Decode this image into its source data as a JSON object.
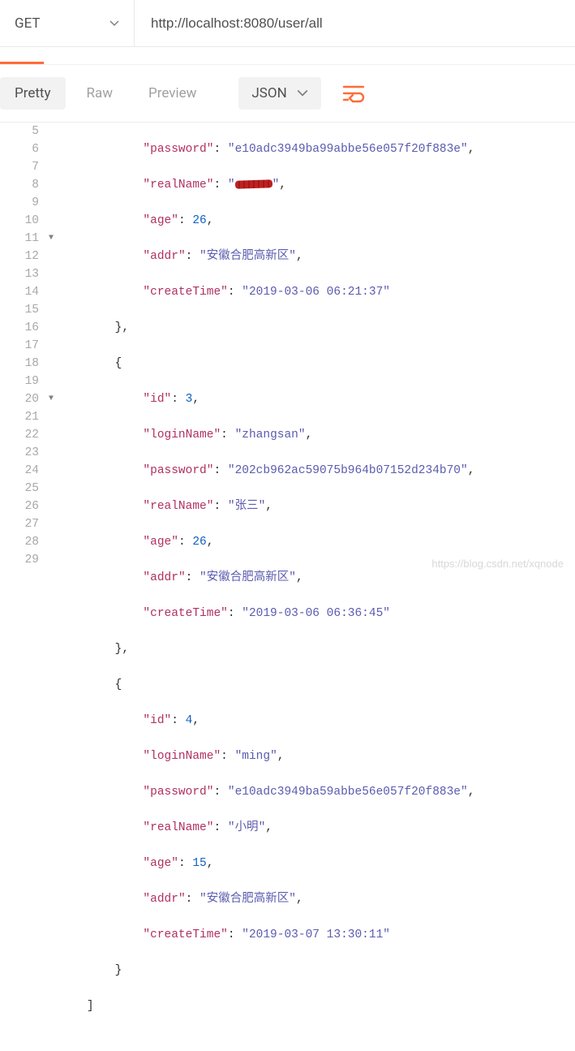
{
  "request": {
    "method": "GET",
    "url": "http://localhost:8080/user/all"
  },
  "tabs": {
    "pretty": "Pretty",
    "raw": "Raw",
    "preview": "Preview"
  },
  "format": {
    "label": "JSON"
  },
  "code": {
    "lines": [
      "5",
      "6",
      "7",
      "8",
      "9",
      "10",
      "11",
      "12",
      "13",
      "14",
      "15",
      "16",
      "17",
      "18",
      "19",
      "20",
      "21",
      "22",
      "23",
      "24",
      "25",
      "26",
      "27",
      "28",
      "29"
    ],
    "r1": {
      "passwordKey": "password",
      "passwordVal": "e10adc3949ba99abbe56e057f20f883e",
      "realNameKey": "realName",
      "ageKey": "age",
      "ageVal": 26,
      "addrKey": "addr",
      "addrVal": "安徽合肥高新区",
      "createTimeKey": "createTime",
      "createTimeVal": "2019-03-06 06:21:37"
    },
    "r2": {
      "idKey": "id",
      "idVal": 3,
      "loginNameKey": "loginName",
      "loginNameVal": "zhangsan",
      "passwordKey": "password",
      "passwordVal": "202cb962ac59075b964b07152d234b70",
      "realNameKey": "realName",
      "realNameVal": "张三",
      "ageKey": "age",
      "ageVal": 26,
      "addrKey": "addr",
      "addrVal": "安徽合肥高新区",
      "createTimeKey": "createTime",
      "createTimeVal": "2019-03-06 06:36:45"
    },
    "r3": {
      "idKey": "id",
      "idVal": 4,
      "loginNameKey": "loginName",
      "loginNameVal": "ming",
      "passwordKey": "password",
      "passwordVal": "e10adc3949ba59abbe56e057f20f883e",
      "realNameKey": "realName",
      "realNameVal": "小明",
      "ageKey": "age",
      "ageVal": 15,
      "addrKey": "addr",
      "addrVal": "安徽合肥高新区",
      "createTimeKey": "createTime",
      "createTimeVal": "2019-03-07 13:30:11"
    }
  },
  "watermark": "https://blog.csdn.net/xqnode"
}
